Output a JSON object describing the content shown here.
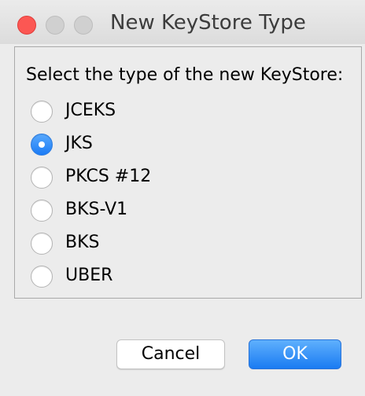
{
  "window": {
    "title": "New KeyStore Type"
  },
  "dialog": {
    "prompt": "Select the type of the new KeyStore:",
    "options": [
      {
        "label": "JCEKS",
        "selected": false
      },
      {
        "label": "JKS",
        "selected": true
      },
      {
        "label": "PKCS #12",
        "selected": false
      },
      {
        "label": "BKS-V1",
        "selected": false
      },
      {
        "label": "BKS",
        "selected": false
      },
      {
        "label": "UBER",
        "selected": false
      }
    ]
  },
  "buttons": {
    "cancel_label": "Cancel",
    "ok_label": "OK"
  },
  "colors": {
    "close_button": "#fc5753",
    "accent": "#1b7bf5"
  }
}
